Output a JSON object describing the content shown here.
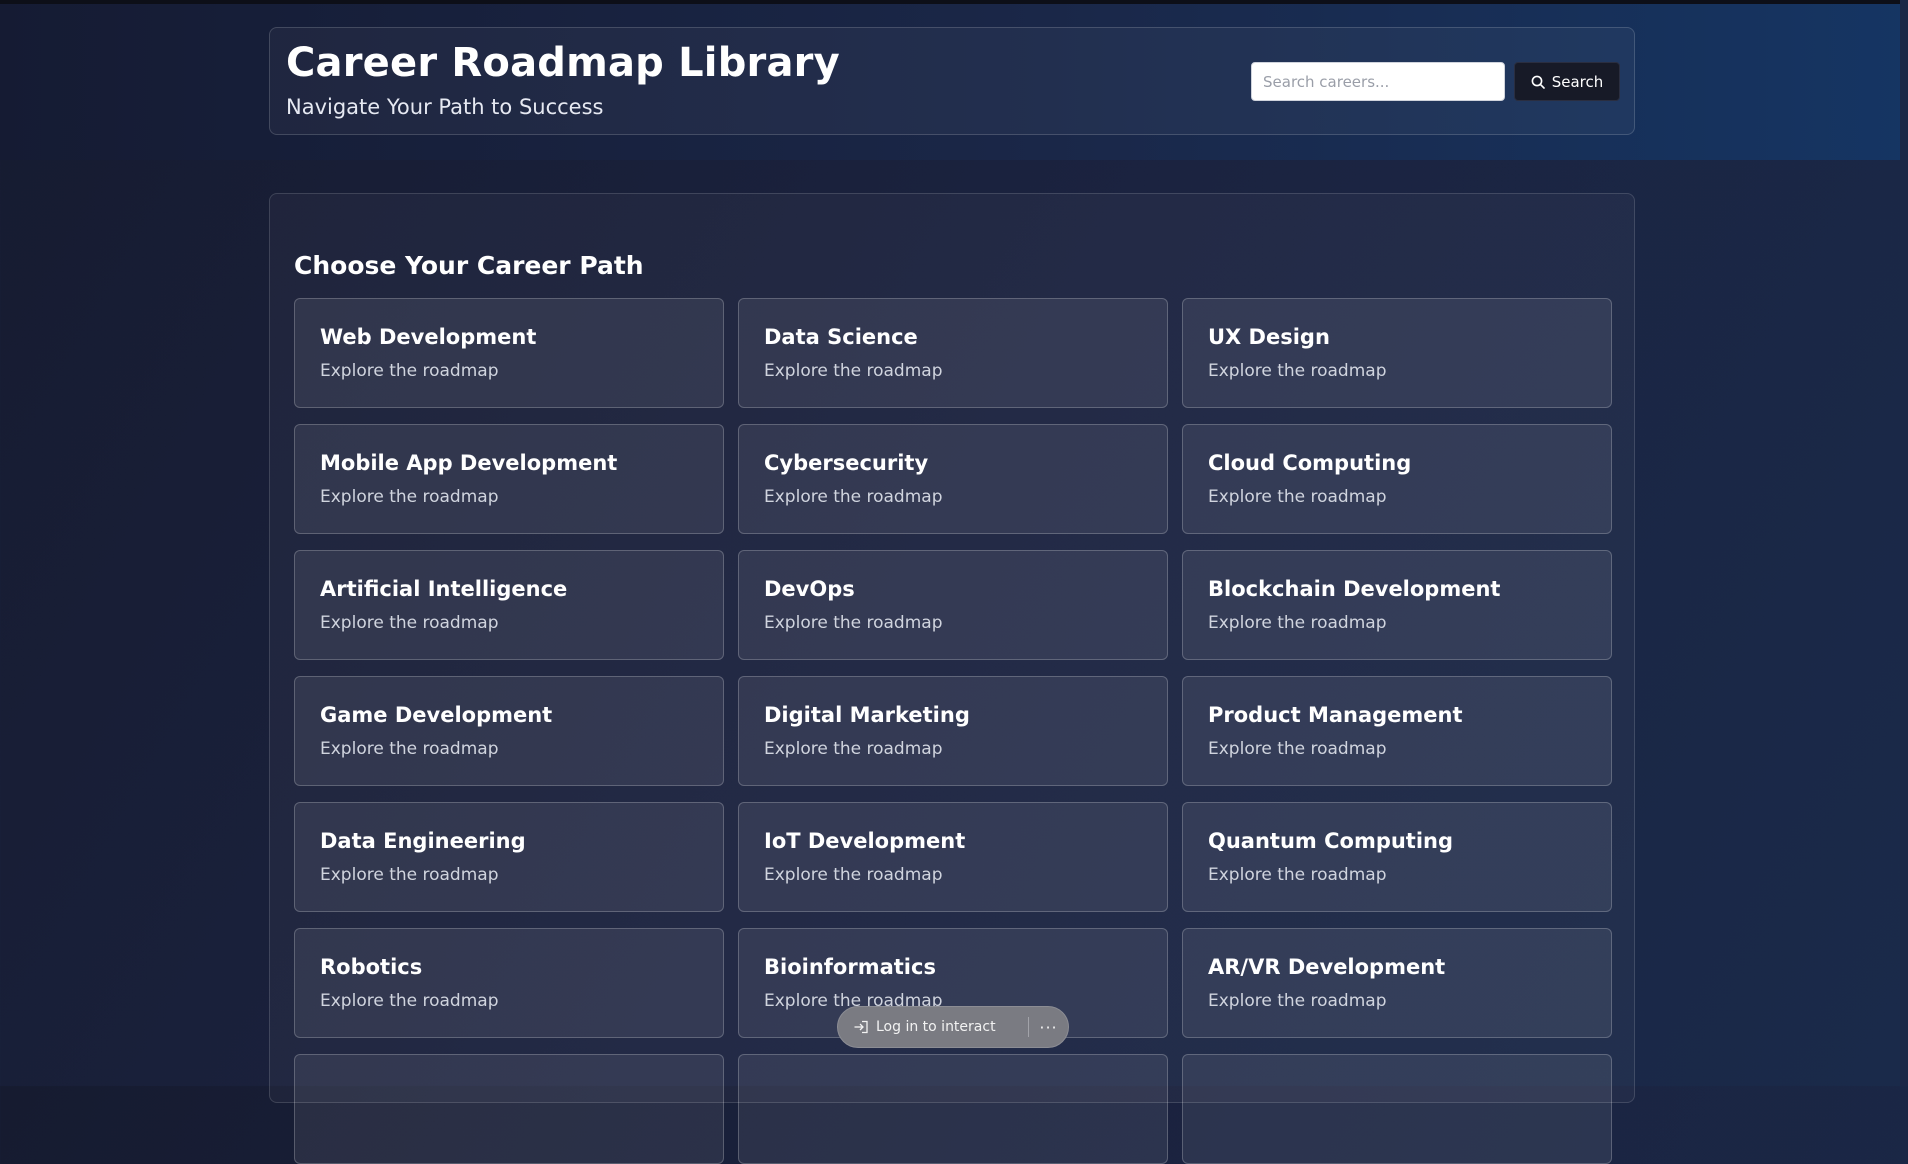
{
  "header": {
    "title": "Career Roadmap Library",
    "subtitle": "Navigate Your Path to Success",
    "search_placeholder": "Search careers...",
    "search_label": "Search"
  },
  "main": {
    "section_title": "Choose Your Career Path",
    "careers": [
      {
        "title": "Web Development",
        "desc": "Explore the roadmap"
      },
      {
        "title": "Data Science",
        "desc": "Explore the roadmap"
      },
      {
        "title": "UX Design",
        "desc": "Explore the roadmap"
      },
      {
        "title": "Mobile App Development",
        "desc": "Explore the roadmap"
      },
      {
        "title": "Cybersecurity",
        "desc": "Explore the roadmap"
      },
      {
        "title": "Cloud Computing",
        "desc": "Explore the roadmap"
      },
      {
        "title": "Artificial Intelligence",
        "desc": "Explore the roadmap"
      },
      {
        "title": "DevOps",
        "desc": "Explore the roadmap"
      },
      {
        "title": "Blockchain Development",
        "desc": "Explore the roadmap"
      },
      {
        "title": "Game Development",
        "desc": "Explore the roadmap"
      },
      {
        "title": "Digital Marketing",
        "desc": "Explore the roadmap"
      },
      {
        "title": "Product Management",
        "desc": "Explore the roadmap"
      },
      {
        "title": "Data Engineering",
        "desc": "Explore the roadmap"
      },
      {
        "title": "IoT Development",
        "desc": "Explore the roadmap"
      },
      {
        "title": "Quantum Computing",
        "desc": "Explore the roadmap"
      },
      {
        "title": "Robotics",
        "desc": "Explore the roadmap"
      },
      {
        "title": "Bioinformatics",
        "desc": "Explore the roadmap"
      },
      {
        "title": "AR/VR Development",
        "desc": "Explore the roadmap"
      },
      {
        "title": "",
        "desc": ""
      },
      {
        "title": "",
        "desc": ""
      },
      {
        "title": "",
        "desc": ""
      }
    ]
  },
  "overlay": {
    "login_label": "Log in to interact",
    "more_label": "···"
  },
  "icons": {
    "search": "search-icon",
    "login": "login-icon",
    "more": "more-icon"
  }
}
